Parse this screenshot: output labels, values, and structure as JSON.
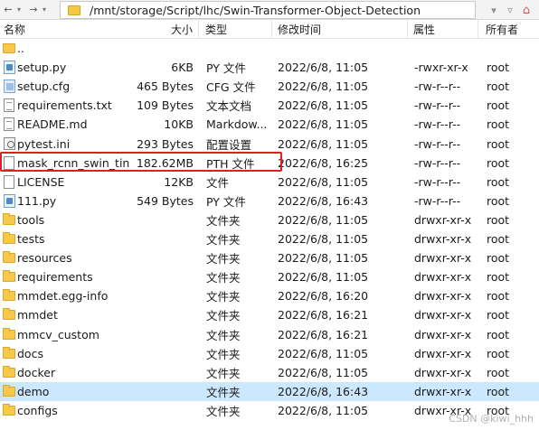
{
  "pathbar": {
    "back_glyph": "←",
    "forward_glyph": "→",
    "path": "/mnt/storage/Script/lhc/Swin-Transformer-Object-Detection"
  },
  "columns": {
    "name": "名称",
    "size": "大小",
    "type": "类型",
    "mtime": "修改时间",
    "attr": "属性",
    "owner": "所有者"
  },
  "rows": [
    {
      "icon": "parent-folder-icon",
      "name": "..",
      "size": "",
      "type": "",
      "mtime": "",
      "attr": "",
      "owner": ""
    },
    {
      "icon": "python-file-icon",
      "name": "setup.py",
      "size": "6KB",
      "type": "PY 文件",
      "mtime": "2022/6/8, 11:05",
      "attr": "-rwxr-xr-x",
      "owner": "root"
    },
    {
      "icon": "config-file-icon",
      "name": "setup.cfg",
      "size": "465 Bytes",
      "type": "CFG 文件",
      "mtime": "2022/6/8, 11:05",
      "attr": "-rw-r--r--",
      "owner": "root"
    },
    {
      "icon": "text-file-icon",
      "name": "requirements.txt",
      "size": "109 Bytes",
      "type": "文本文档",
      "mtime": "2022/6/8, 11:05",
      "attr": "-rw-r--r--",
      "owner": "root"
    },
    {
      "icon": "text-file-icon",
      "name": "README.md",
      "size": "10KB",
      "type": "Markdow...",
      "mtime": "2022/6/8, 11:05",
      "attr": "-rw-r--r--",
      "owner": "root"
    },
    {
      "icon": "settings-file-icon",
      "name": "pytest.ini",
      "size": "293 Bytes",
      "type": "配置设置",
      "mtime": "2022/6/8, 11:05",
      "attr": "-rw-r--r--",
      "owner": "root"
    },
    {
      "icon": "blank-file-icon",
      "name": "mask_rcnn_swin_tin...",
      "size": "182.62MB",
      "type": "PTH 文件",
      "mtime": "2022/6/8, 16:25",
      "attr": "-rw-r--r--",
      "owner": "root"
    },
    {
      "icon": "blank-file-icon",
      "name": "LICENSE",
      "size": "12KB",
      "type": "文件",
      "mtime": "2022/6/8, 11:05",
      "attr": "-rw-r--r--",
      "owner": "root"
    },
    {
      "icon": "python-file-icon",
      "name": "111.py",
      "size": "549 Bytes",
      "type": "PY 文件",
      "mtime": "2022/6/8, 16:43",
      "attr": "-rw-r--r--",
      "owner": "root"
    },
    {
      "icon": "folder-icon",
      "name": "tools",
      "size": "",
      "type": "文件夹",
      "mtime": "2022/6/8, 11:05",
      "attr": "drwxr-xr-x",
      "owner": "root"
    },
    {
      "icon": "folder-icon",
      "name": "tests",
      "size": "",
      "type": "文件夹",
      "mtime": "2022/6/8, 11:05",
      "attr": "drwxr-xr-x",
      "owner": "root"
    },
    {
      "icon": "folder-icon",
      "name": "resources",
      "size": "",
      "type": "文件夹",
      "mtime": "2022/6/8, 11:05",
      "attr": "drwxr-xr-x",
      "owner": "root"
    },
    {
      "icon": "folder-icon",
      "name": "requirements",
      "size": "",
      "type": "文件夹",
      "mtime": "2022/6/8, 11:05",
      "attr": "drwxr-xr-x",
      "owner": "root"
    },
    {
      "icon": "folder-icon",
      "name": "mmdet.egg-info",
      "size": "",
      "type": "文件夹",
      "mtime": "2022/6/8, 16:20",
      "attr": "drwxr-xr-x",
      "owner": "root"
    },
    {
      "icon": "folder-icon",
      "name": "mmdet",
      "size": "",
      "type": "文件夹",
      "mtime": "2022/6/8, 16:21",
      "attr": "drwxr-xr-x",
      "owner": "root"
    },
    {
      "icon": "folder-icon",
      "name": "mmcv_custom",
      "size": "",
      "type": "文件夹",
      "mtime": "2022/6/8, 16:21",
      "attr": "drwxr-xr-x",
      "owner": "root"
    },
    {
      "icon": "folder-icon",
      "name": "docs",
      "size": "",
      "type": "文件夹",
      "mtime": "2022/6/8, 11:05",
      "attr": "drwxr-xr-x",
      "owner": "root"
    },
    {
      "icon": "folder-icon",
      "name": "docker",
      "size": "",
      "type": "文件夹",
      "mtime": "2022/6/8, 11:05",
      "attr": "drwxr-xr-x",
      "owner": "root"
    },
    {
      "icon": "folder-icon",
      "name": "demo",
      "size": "",
      "type": "文件夹",
      "mtime": "2022/6/8, 16:43",
      "attr": "drwxr-xr-x",
      "owner": "root",
      "selected": true
    },
    {
      "icon": "folder-icon",
      "name": "configs",
      "size": "",
      "type": "文件夹",
      "mtime": "2022/6/8, 11:05",
      "attr": "drwxr-xr-x",
      "owner": "root"
    }
  ],
  "highlighted_row": "mask_rcnn_swin_tin...",
  "watermark": "CSDN @kiwi_hhh",
  "colors": {
    "selection": "#cce8ff",
    "highlight_border": "#e02020",
    "folder": "#f7c948"
  }
}
